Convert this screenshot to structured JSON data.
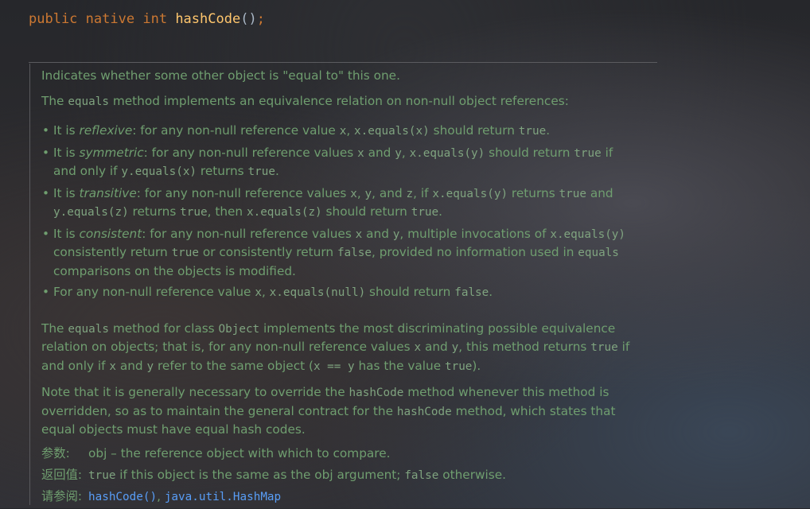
{
  "signature": {
    "mod1": "public",
    "mod2": "native",
    "ret": "int",
    "name": "hashCode",
    "open": "(",
    "close": ")",
    "semi": ";"
  },
  "doc": {
    "intro": "Indicates whether some other object is \"equal to\" this one.",
    "eq_p": {
      "a": "The ",
      "code": "equals",
      "b": " method implements an equivalence relation on non-null object references:"
    },
    "b1": {
      "a": "It is ",
      "em": "reflexive",
      "b": ": for any non-null reference value ",
      "c1": "x",
      "d": ", ",
      "c2": "x.equals(x)",
      "e": " should return ",
      "c3": "true",
      "f": "."
    },
    "b2": {
      "a": "It is ",
      "em": "symmetric",
      "b": ": for any non-null reference values ",
      "c1": "x",
      "d": " and ",
      "c2": "y",
      "e": ", ",
      "c3": "x.equals(y)",
      "f": " should return ",
      "c4": "true",
      "g": " if and only if ",
      "c5": "y.equals(x)",
      "h": " returns ",
      "c6": "true",
      "i": "."
    },
    "b3": {
      "a": "It is ",
      "em": "transitive",
      "b": ": for any non-null reference values ",
      "c1": "x",
      "d": ", ",
      "c2": "y",
      "e": ", and ",
      "c3": "z",
      "f": ", if ",
      "c4": "x.equals(y)",
      "g": " returns ",
      "c5": "true",
      "h": " and ",
      "c6": "y.equals(z)",
      "i": " returns ",
      "c7": "true",
      "j": ", then ",
      "c8": "x.equals(z)",
      "k": " should return ",
      "c9": "true",
      "l": "."
    },
    "b4": {
      "a": "It is ",
      "em": "consistent",
      "b": ": for any non-null reference values ",
      "c1": "x",
      "d": " and ",
      "c2": "y",
      "e": ", multiple invocations of ",
      "c3": "x.equals(y)",
      "f": " consistently return ",
      "c4": "true",
      "g": " or consistently return ",
      "c5": "false",
      "h": ", provided no information used in ",
      "c6": "equals",
      "i": " comparisons on the objects is modified."
    },
    "b5": {
      "a": "For any non-null reference value ",
      "c1": "x",
      "b": ", ",
      "c2": "x.equals(null)",
      "d": " should return ",
      "c3": "false",
      "e": "."
    },
    "p3": {
      "a": "The ",
      "c1": "equals",
      "b": " method for class ",
      "c2": "Object",
      "c": " implements the most discriminating possible equivalence relation on objects; that is, for any non-null reference values ",
      "c3": "x",
      "d": " and ",
      "c4": "y",
      "e": ", this method returns ",
      "c5": "true",
      "f": " if and only if ",
      "c6": "x",
      "g": " and ",
      "c7": "y",
      "h": " refer to the same object (",
      "c8": "x == y",
      "i": " has the value ",
      "c9": "true",
      "j": ")."
    },
    "p4": {
      "a": "Note that it is generally necessary to override the ",
      "c1": "hashCode",
      "b": " method whenever this method is overridden, so as to maintain the general contract for the ",
      "c2": "hashCode",
      "c": " method, which states that equal objects must have equal hash codes."
    },
    "params_label": "参数:",
    "params_text": "obj – the reference object with which to compare.",
    "returns_label": "返回值:",
    "returns_c1": "true",
    "returns_a": " if this object is the same as the obj argument; ",
    "returns_c2": "false",
    "returns_b": " otherwise.",
    "see_label": "请参阅:",
    "see_link1": "hashCode()",
    "see_sep": ", ",
    "see_link2": "java.util.HashMap"
  }
}
